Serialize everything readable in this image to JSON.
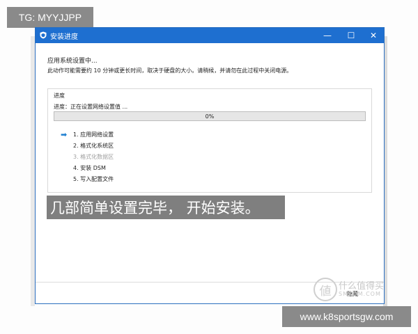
{
  "overlay_tag": "TG: MYYJJPP",
  "window": {
    "title": "安装进度",
    "controls": {
      "minimize": "—",
      "maximize": "☐",
      "close": "✕"
    }
  },
  "main": {
    "heading": "应用系统设置中...",
    "description": "此动作可能需要约 10 分钟或更长时间，取决于硬盘的大小。请稍候，并请勿在此过程中关闭电源。"
  },
  "progress_group": {
    "title": "进度",
    "status": "进度：正在设置网络设置值 ...",
    "percent_text": "0%",
    "percent_value": 0,
    "steps": [
      {
        "label": "1. 应用网络设置",
        "state": "current"
      },
      {
        "label": "2. 格式化系统区",
        "state": "pending"
      },
      {
        "label": "3. 格式化数据区",
        "state": "disabled"
      },
      {
        "label": "4. 安装 DSM",
        "state": "pending"
      },
      {
        "label": "5. 写入配置文件",
        "state": "pending"
      }
    ]
  },
  "footer": {
    "cancel_label": "隐藏"
  },
  "caption": "几部简单设置完毕， 开始安装。",
  "watermark": {
    "text": "什么值得买",
    "sub": "SMZDM.COM"
  },
  "url_overlay": "www.k8sportsgw.com",
  "colors": {
    "titlebar": "#1e6fd0",
    "progress_fill": "#06b025",
    "step_arrow": "#1e7fd0"
  }
}
